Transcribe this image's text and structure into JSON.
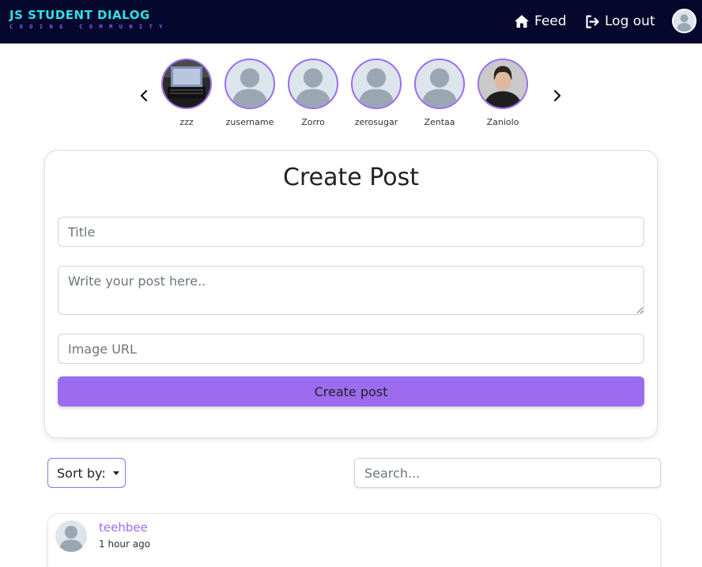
{
  "brand": {
    "title": "JS STUDENT DIALOG",
    "subtitle": "CODING COMMUNITY"
  },
  "nav": {
    "feed": "Feed",
    "logout": "Log out"
  },
  "users": [
    {
      "name": "zzz",
      "avatar": "laptop-photo"
    },
    {
      "name": "zusername",
      "avatar": "default-silhouette"
    },
    {
      "name": "Zorro",
      "avatar": "default-silhouette"
    },
    {
      "name": "zerosugar",
      "avatar": "default-silhouette"
    },
    {
      "name": "Zentaa",
      "avatar": "default-silhouette"
    },
    {
      "name": "Zaniolo",
      "avatar": "portrait-photo"
    }
  ],
  "create_post": {
    "heading": "Create Post",
    "title_placeholder": "Title",
    "body_placeholder": "Write your post here..",
    "image_placeholder": "Image URL",
    "button_label": "Create post"
  },
  "controls": {
    "sort_label": "Sort by:",
    "search_placeholder": "Search..."
  },
  "posts": [
    {
      "author": "teehbee",
      "time": "1 hour ago"
    }
  ],
  "colors": {
    "navbar": "#05072c",
    "brand_cyan": "#2fe0e8",
    "accent": "#9b6cf0"
  }
}
